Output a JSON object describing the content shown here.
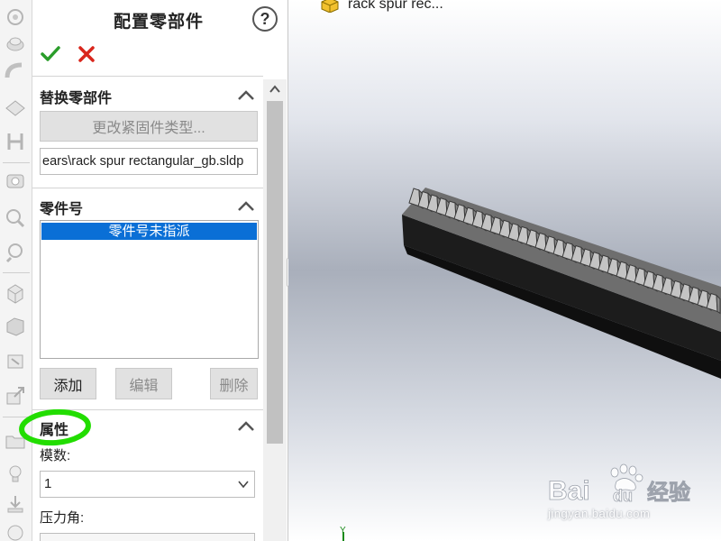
{
  "panel": {
    "title": "配置零部件",
    "help_icon": "question-mark-icon",
    "confirm_icon": "green-checkmark-icon",
    "cancel_icon": "red-x-icon"
  },
  "replace_section": {
    "title": "替换零部件",
    "change_fastener_button": "更改紧固件类型...",
    "file_path": "ears\\rack spur rectangular_gb.sldp"
  },
  "part_number_section": {
    "title": "零件号",
    "selected_item": "零件号未指派",
    "add_button": "添加",
    "edit_button": "编辑",
    "delete_button": "删除"
  },
  "properties_section": {
    "title": "属性",
    "module_label": "模数:",
    "module_value": "1",
    "pressure_angle_label": "压力角:"
  },
  "viewport": {
    "tree_label": "rack spur rec..."
  },
  "watermark": {
    "logo": "Baidu经验",
    "url": "jingyan.baidu.com"
  },
  "colors": {
    "selection": "#0a6fd6",
    "confirm": "#2a9d2a",
    "cancel": "#d9261c",
    "highlight": "#22dd00"
  }
}
